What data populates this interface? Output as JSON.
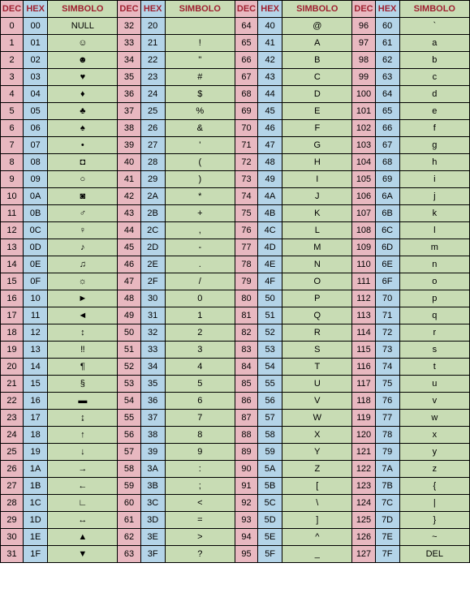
{
  "chart_data": {
    "type": "table",
    "title": "ASCII Table",
    "headers": [
      "DEC",
      "HEX",
      "SIMBOLO",
      "DEC",
      "HEX",
      "SIMBOLO",
      "DEC",
      "HEX",
      "SIMBOLO",
      "DEC",
      "HEX",
      "SIMBOLO"
    ],
    "rows": [
      [
        "0",
        "00",
        "NULL",
        "32",
        "20",
        "",
        "64",
        "40",
        "@",
        "96",
        "60",
        "`"
      ],
      [
        "1",
        "01",
        "☺",
        "33",
        "21",
        "!",
        "65",
        "41",
        "A",
        "97",
        "61",
        "a"
      ],
      [
        "2",
        "02",
        "☻",
        "34",
        "22",
        "\"",
        "66",
        "42",
        "B",
        "98",
        "62",
        "b"
      ],
      [
        "3",
        "03",
        "♥",
        "35",
        "23",
        "#",
        "67",
        "43",
        "C",
        "99",
        "63",
        "c"
      ],
      [
        "4",
        "04",
        "♦",
        "36",
        "24",
        "$",
        "68",
        "44",
        "D",
        "100",
        "64",
        "d"
      ],
      [
        "5",
        "05",
        "♣",
        "37",
        "25",
        "%",
        "69",
        "45",
        "E",
        "101",
        "65",
        "e"
      ],
      [
        "6",
        "06",
        "♠",
        "38",
        "26",
        "&",
        "70",
        "46",
        "F",
        "102",
        "66",
        "f"
      ],
      [
        "7",
        "07",
        "•",
        "39",
        "27",
        "'",
        "71",
        "47",
        "G",
        "103",
        "67",
        "g"
      ],
      [
        "8",
        "08",
        "◘",
        "40",
        "28",
        "(",
        "72",
        "48",
        "H",
        "104",
        "68",
        "h"
      ],
      [
        "9",
        "09",
        "○",
        "41",
        "29",
        ")",
        "73",
        "49",
        "I",
        "105",
        "69",
        "i"
      ],
      [
        "10",
        "0A",
        "◙",
        "42",
        "2A",
        "*",
        "74",
        "4A",
        "J",
        "106",
        "6A",
        "j"
      ],
      [
        "11",
        "0B",
        "♂",
        "43",
        "2B",
        "+",
        "75",
        "4B",
        "K",
        "107",
        "6B",
        "k"
      ],
      [
        "12",
        "0C",
        "♀",
        "44",
        "2C",
        ",",
        "76",
        "4C",
        "L",
        "108",
        "6C",
        "l"
      ],
      [
        "13",
        "0D",
        "♪",
        "45",
        "2D",
        "-",
        "77",
        "4D",
        "M",
        "109",
        "6D",
        "m"
      ],
      [
        "14",
        "0E",
        "♫",
        "46",
        "2E",
        ".",
        "78",
        "4E",
        "N",
        "110",
        "6E",
        "n"
      ],
      [
        "15",
        "0F",
        "☼",
        "47",
        "2F",
        "/",
        "79",
        "4F",
        "O",
        "111",
        "6F",
        "o"
      ],
      [
        "16",
        "10",
        "►",
        "48",
        "30",
        "0",
        "80",
        "50",
        "P",
        "112",
        "70",
        "p"
      ],
      [
        "17",
        "11",
        "◄",
        "49",
        "31",
        "1",
        "81",
        "51",
        "Q",
        "113",
        "71",
        "q"
      ],
      [
        "18",
        "12",
        "↕",
        "50",
        "32",
        "2",
        "82",
        "52",
        "R",
        "114",
        "72",
        "r"
      ],
      [
        "19",
        "13",
        "‼",
        "51",
        "33",
        "3",
        "83",
        "53",
        "S",
        "115",
        "73",
        "s"
      ],
      [
        "20",
        "14",
        "¶",
        "52",
        "34",
        "4",
        "84",
        "54",
        "T",
        "116",
        "74",
        "t"
      ],
      [
        "21",
        "15",
        "§",
        "53",
        "35",
        "5",
        "85",
        "55",
        "U",
        "117",
        "75",
        "u"
      ],
      [
        "22",
        "16",
        "▬",
        "54",
        "36",
        "6",
        "86",
        "56",
        "V",
        "118",
        "76",
        "v"
      ],
      [
        "23",
        "17",
        "↨",
        "55",
        "37",
        "7",
        "87",
        "57",
        "W",
        "119",
        "77",
        "w"
      ],
      [
        "24",
        "18",
        "↑",
        "56",
        "38",
        "8",
        "88",
        "58",
        "X",
        "120",
        "78",
        "x"
      ],
      [
        "25",
        "19",
        "↓",
        "57",
        "39",
        "9",
        "89",
        "59",
        "Y",
        "121",
        "79",
        "y"
      ],
      [
        "26",
        "1A",
        "→",
        "58",
        "3A",
        ":",
        "90",
        "5A",
        "Z",
        "122",
        "7A",
        "z"
      ],
      [
        "27",
        "1B",
        "←",
        "59",
        "3B",
        ";",
        "91",
        "5B",
        "[",
        "123",
        "7B",
        "{"
      ],
      [
        "28",
        "1C",
        "∟",
        "60",
        "3C",
        "<",
        "92",
        "5C",
        "\\",
        "124",
        "7C",
        "|"
      ],
      [
        "29",
        "1D",
        "↔",
        "61",
        "3D",
        "=",
        "93",
        "5D",
        "]",
        "125",
        "7D",
        "}"
      ],
      [
        "30",
        "1E",
        "▲",
        "62",
        "3E",
        ">",
        "94",
        "5E",
        "^",
        "126",
        "7E",
        "~"
      ],
      [
        "31",
        "1F",
        "▼",
        "63",
        "3F",
        "?",
        "95",
        "5F",
        "_",
        "127",
        "7F",
        "DEL"
      ]
    ]
  }
}
